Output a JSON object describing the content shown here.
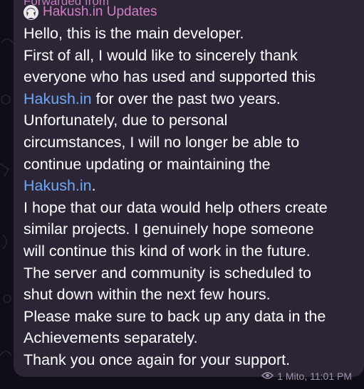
{
  "forward": {
    "header_label": "Forwarded from",
    "channel_name": "Hakush.in Updates",
    "avatar_icon": "character-avatar-icon"
  },
  "message": {
    "lines": [
      {
        "pre": "Hello, this is the main developer.",
        "link": "",
        "post": ""
      },
      {
        "pre": "First of all, I would like to sincerely thank",
        "link": "",
        "post": ""
      },
      {
        "pre": "everyone who has used and supported this",
        "link": "",
        "post": ""
      },
      {
        "pre": "",
        "link": "Hakush.in",
        "post": " for over the past two years."
      },
      {
        "pre": "Unfortunately, due to personal",
        "link": "",
        "post": ""
      },
      {
        "pre": "circumstances, I will no longer be able to",
        "link": "",
        "post": ""
      },
      {
        "pre": "continue updating or maintaining the",
        "link": "",
        "post": ""
      },
      {
        "pre": "",
        "link": "Hakush.in",
        "post": "."
      },
      {
        "pre": "I hope that our data would help others create",
        "link": "",
        "post": ""
      },
      {
        "pre": "similar projects. I genuinely hope someone",
        "link": "",
        "post": ""
      },
      {
        "pre": "will continue this kind of work in the future.",
        "link": "",
        "post": ""
      },
      {
        "pre": "The server and community is scheduled to",
        "link": "",
        "post": ""
      },
      {
        "pre": "shut down within the next few hours.",
        "link": "",
        "post": ""
      },
      {
        "pre": "Please make sure to back up any data in the",
        "link": "",
        "post": ""
      },
      {
        "pre": "Achievements separately.",
        "link": "",
        "post": ""
      },
      {
        "pre": "Thank you once again for your support.",
        "link": "",
        "post": ""
      }
    ]
  },
  "meta": {
    "views_icon": "eye-icon",
    "timestamp": "1 Mito, 11:01 PM"
  },
  "colors": {
    "link": "#6ea8f4",
    "channel": "#d27fc6",
    "bubble": "#2b2536"
  }
}
